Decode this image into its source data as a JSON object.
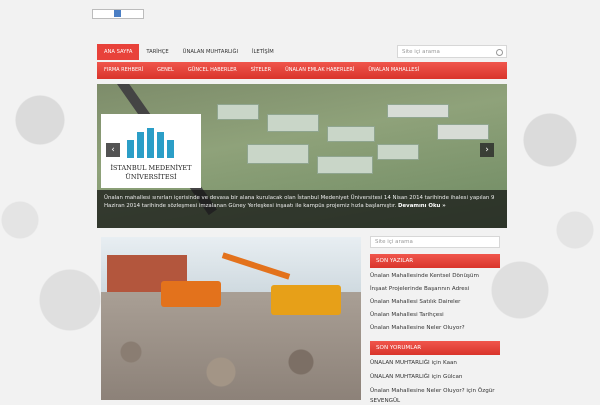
{
  "nav_top": [
    "ANA SAYFA",
    "TARİHÇE",
    "ÜNALAN MUHTARLIĞI",
    "İLETİŞİM"
  ],
  "search": {
    "placeholder": "Site içi arama"
  },
  "nav_categories": [
    "FIRMA REHBERİ",
    "GENEL",
    "GÜNCEL HABERLER",
    "SİTELER",
    "ÜNALAN EMLAK HABERLERİ",
    "ÜNALAN MAHALLESİ"
  ],
  "slider": {
    "logo_line1": "İSTANBUL MEDENİYET",
    "logo_line2": "ÜNİVERSİTESİ",
    "caption": "Ünalan mahallesi sınırları içerisinde ve devasa bir alana kurulacak olan İstanbul Medeniyet Üniversitesi 14 Nisan 2014 tarihinde ihalesi yapılan 9 Haziran 2014 tarihinde sözleşmesi imzalanan Güney Yerleşkesi inşaatı ile kampüs projemiz hızla başlamıştır.",
    "more_label": "Devamını Oku »"
  },
  "sidebar": {
    "search_placeholder": "Site içi arama",
    "recent_title": "SON YAZILAR",
    "recent_posts": [
      "Ünalan Mahallesinde Kentsel Dönüşüm",
      "İnşaat Projelerinde Başarının Adresi",
      "Ünalan Mahallesi Satılık Daireler",
      "Ünalan Mahallesi Tarihçesi",
      "Ünalan Mahallesine Neler Oluyor?"
    ],
    "comments_title": "SON YORUMLAR",
    "comments": [
      "ÜNALAN MUHTARLIĞI için Kaan",
      "ÜNALAN MUHTARLIĞI için Gülcan",
      "Ünalan Mahallesine Neler Oluyor? için Özgür",
      "SEVENGÜL"
    ]
  },
  "colors": {
    "accent": "#e8423a"
  }
}
